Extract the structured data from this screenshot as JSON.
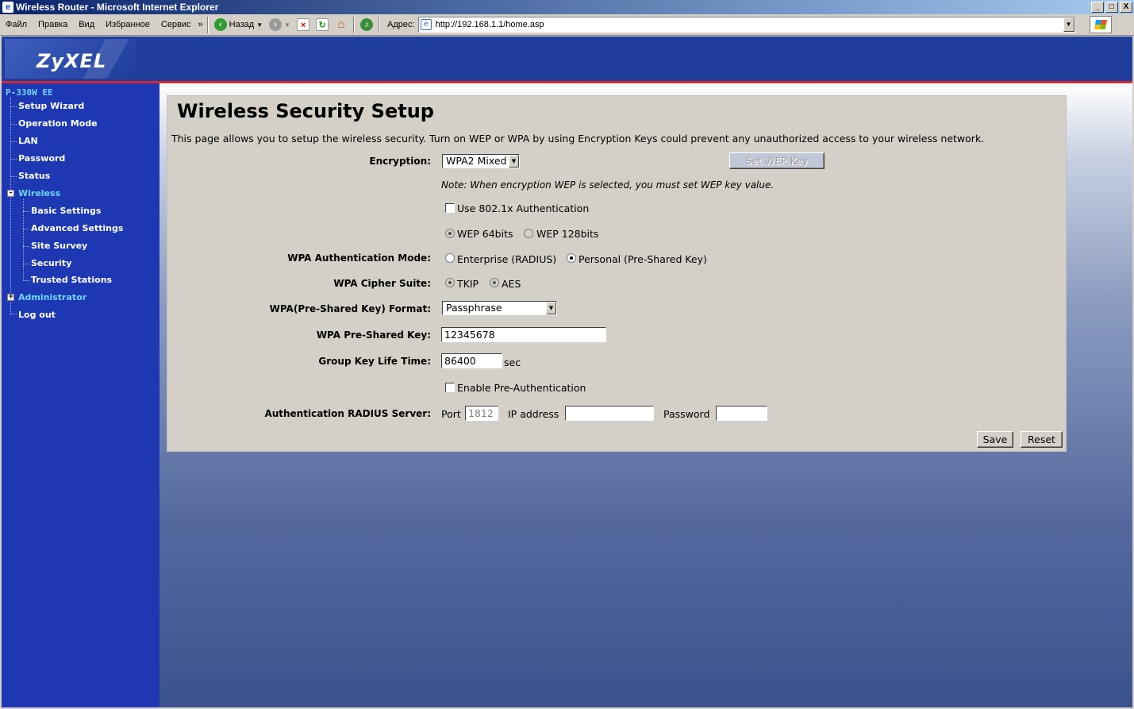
{
  "window": {
    "title": "Wireless Router - Microsoft Internet Explorer",
    "controls": [
      "_",
      "□",
      "X"
    ]
  },
  "menu": [
    "Файл",
    "Правка",
    "Вид",
    "Избранное",
    "Сервис"
  ],
  "toolbar": {
    "chevron": "»",
    "back_label": "Назад",
    "address_label": "Адрес:",
    "address_value": "http://192.168.1.1/home.asp",
    "icons": [
      "back-icon",
      "forward-icon",
      "stop-icon",
      "refresh-icon",
      "home-icon",
      "media-icon"
    ]
  },
  "brand": {
    "logo": "ZyXEL"
  },
  "sidebar": {
    "root": "P-330W EE",
    "items": [
      {
        "label": "Setup Wizard"
      },
      {
        "label": "Operation Mode"
      },
      {
        "label": "LAN"
      },
      {
        "label": "Password"
      },
      {
        "label": "Status"
      },
      {
        "label": "Wireless",
        "expanded": true,
        "active": true,
        "children": [
          "Basic Settings",
          "Advanced Settings",
          "Site Survey",
          "Security",
          "Trusted Stations"
        ]
      },
      {
        "label": "Administrator",
        "expanded": false,
        "active": true
      },
      {
        "label": "Log out"
      }
    ],
    "expand_minus": "-",
    "expand_plus": "+"
  },
  "page": {
    "title": "Wireless Security Setup",
    "description": "This page allows you to setup the wireless security. Turn on WEP or WPA by using Encryption Keys could prevent any unauthorized access to your wireless network.",
    "encryption_label": "Encryption:",
    "encryption_value": "WPA2 Mixed",
    "set_wep_key_button": "Set WEP Key",
    "note": "Note: When encryption WEP is selected, you must set WEP key value.",
    "use_8021x_label": "Use 802.1x Authentication",
    "use_8021x_checked": false,
    "wep64_label": "WEP 64bits",
    "wep128_label": "WEP 128bits",
    "wpa_auth_mode_label": "WPA Authentication Mode:",
    "wpa_auth_enterprise": "Enterprise (RADIUS)",
    "wpa_auth_personal": "Personal (Pre-Shared Key)",
    "wpa_auth_selected": "Personal (Pre-Shared Key)",
    "wpa_cipher_label": "WPA Cipher Suite:",
    "cipher_tkip": "TKIP",
    "cipher_aes": "AES",
    "psk_format_label": "WPA(Pre-Shared Key) Format:",
    "psk_format_value": "Passphrase",
    "psk_label": "WPA Pre-Shared Key:",
    "psk_value": "12345678",
    "group_key_label": "Group Key Life Time:",
    "group_key_value": "86400",
    "group_key_unit": "sec",
    "pre_auth_label": "Enable Pre-Authentication",
    "pre_auth_checked": false,
    "radius_label": "Authentication RADIUS Server:",
    "radius_port_label": "Port",
    "radius_port_value": "1812",
    "radius_ip_label": "IP address",
    "radius_ip_value": "",
    "radius_password_label": "Password",
    "radius_password_value": "",
    "save_button": "Save",
    "reset_button": "Reset"
  },
  "colors": {
    "sidebar_bg": "#1e38b4",
    "header_bg": "#1f3e9c",
    "accent_red": "#d9272e",
    "active_link": "#6fd6ff",
    "panel_bg": "#d4d0c8"
  }
}
